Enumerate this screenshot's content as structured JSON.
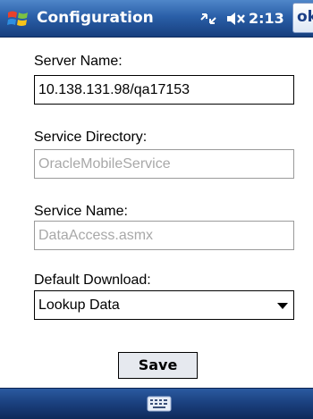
{
  "titlebar": {
    "title": "Configuration",
    "time": "2:13",
    "ok_label": "ok",
    "icons": [
      "windows-start-icon",
      "connectivity-icon",
      "volume-mute-icon"
    ]
  },
  "form": {
    "server_name": {
      "label": "Server Name:",
      "value": "10.138.131.98/qa17153"
    },
    "service_directory": {
      "label": "Service Directory:",
      "value": "OracleMobileService"
    },
    "service_name": {
      "label": "Service Name:",
      "value": "DataAccess.asmx"
    },
    "default_download": {
      "label": "Default Download:",
      "selected": "Lookup Data"
    },
    "save_label": "Save"
  },
  "bottombar": {
    "icons": [
      "keyboard-icon"
    ]
  },
  "colors": {
    "titlebar_top": "#4f86c9",
    "titlebar_bottom": "#173f7e",
    "disabled_text": "#a8a8a8",
    "button_face": "#e6e9ef"
  }
}
